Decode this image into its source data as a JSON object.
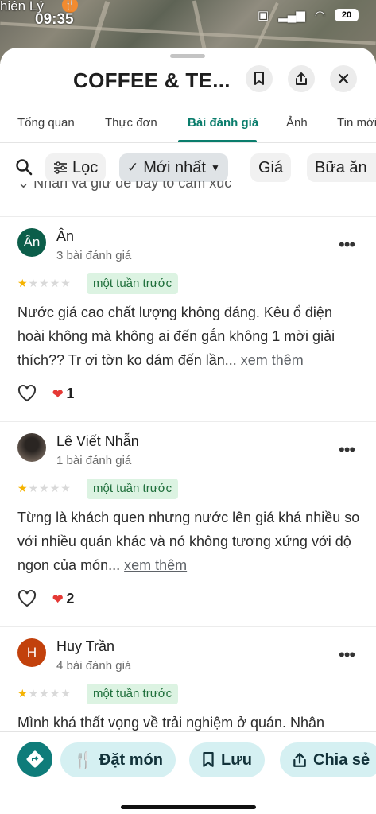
{
  "status_bar": {
    "time": "09:35",
    "place_label": "hiên Lý",
    "battery": "20"
  },
  "header": {
    "title": "COFFEE & TE..."
  },
  "tabs": [
    {
      "label": "Tổng quan"
    },
    {
      "label": "Thực đơn"
    },
    {
      "label": "Bài đánh giá",
      "active": true
    },
    {
      "label": "Ảnh"
    },
    {
      "label": "Tin mới"
    }
  ],
  "filters": {
    "filter_label": "Lọc",
    "sort_label": "Mới nhất",
    "price_label": "Giá",
    "meal_label": "Bữa ăn"
  },
  "hint": "Nhấn và giữ để bày tỏ cảm xúc",
  "reviews": [
    {
      "initial": "Ân",
      "name": "Ân",
      "count": "3 bài đánh giá",
      "rating": 1,
      "time": "một tuần trước",
      "text": "Nước giá cao chất lượng không đáng. Kêu ổ điện hoài không mà không ai đến gắn không 1 mời giải thích?? Tr ơi tờn ko dám đến lần...",
      "see_more": "xem thêm",
      "reaction_count": "1",
      "avatar_color": "#0c5e4a"
    },
    {
      "initial": "",
      "name": "Lê Viết Nhẫn",
      "count": "1 bài đánh giá",
      "rating": 1,
      "time": "một tuần trước",
      "text": "Từng là khách quen nhưng nước lên giá khá nhiều so với nhiều quán khác và nó không tương xứng với độ ngon của món...",
      "see_more": "xem thêm",
      "reaction_count": "2",
      "avatar_color": "#4a3f36"
    },
    {
      "initial": "H",
      "name": "Huy Trần",
      "count": "4 bài đánh giá",
      "rating": 1,
      "time": "một tuần trước",
      "text": "Mình khá thất vọng về trải nghiệm ở quán. Nhân",
      "avatar_color": "#c2410c"
    }
  ],
  "bottom_bar": {
    "order_label": "Đặt món",
    "save_label": "Lưu",
    "share_label": "Chia sẻ"
  },
  "colors": {
    "accent": "#0a7d6c",
    "badge_bg": "#dcf3e2",
    "action_bg": "#d5f0f2"
  }
}
